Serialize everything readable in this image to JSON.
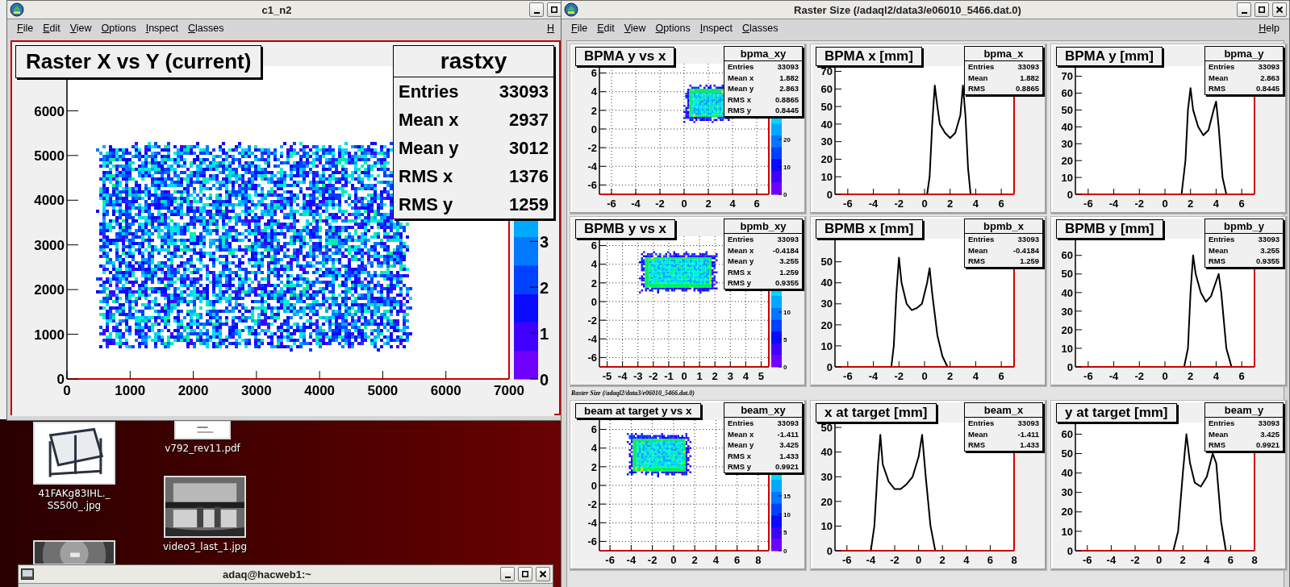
{
  "desktop": {
    "icons": [
      {
        "kind": "picture",
        "label_lines": [
          "41FAKg83IHL._",
          "SS500_.jpg"
        ]
      },
      {
        "kind": "picture",
        "label_lines": [
          "v792_rev11.pdf"
        ]
      },
      {
        "kind": "picture",
        "label_lines": [
          "video3_last_1.jpg"
        ]
      },
      {
        "kind": "picture"
      }
    ]
  },
  "windows": [
    {
      "title": "c1_n2",
      "buttons": [
        {
          "kind": "minimize"
        },
        {
          "kind": "maximize"
        }
      ],
      "menu": [
        "File",
        "Edit",
        "View",
        "Options",
        "Inspect",
        "Classes"
      ],
      "menu_right": "H",
      "pads": [
        {
          "kind": "hist2d_large",
          "title": "Raster X vs Y (current)",
          "xticks": [
            "0",
            "1000",
            "2000",
            "3000",
            "4000",
            "5000",
            "6000",
            "7000"
          ],
          "yticks": [
            "6000",
            "5000",
            "4000",
            "3000",
            "2000",
            "1000",
            "0"
          ],
          "palette_ticks": [
            "3",
            "2",
            "1",
            "0"
          ],
          "stats": {
            "name": "rastxy",
            "rows": [
              {
                "label": "Entries",
                "value": "33093"
              },
              {
                "label": "Mean x",
                "value": "2937"
              },
              {
                "label": "Mean y",
                "value": "3012"
              },
              {
                "label": "RMS x",
                "value": "1376"
              },
              {
                "label": "RMS y",
                "value": "1259"
              }
            ]
          }
        }
      ]
    },
    {
      "title": "Raster Size (/adaql2/data3/e06010_5466.dat.0)",
      "buttons": [
        {
          "kind": "minimize"
        },
        {
          "kind": "maximize"
        },
        {
          "kind": "close"
        }
      ],
      "menu": [
        "File",
        "Edit",
        "View",
        "Options",
        "Inspect",
        "Classes"
      ],
      "menu_right": "Help",
      "caption": "Raster Size (/adaql2/data3/e06010_5466.dat.0)",
      "pads": [
        {
          "kind": "hist2d",
          "title": "BPMA y vs x",
          "xticks": [
            "-6",
            "-4",
            "-2",
            "0",
            "2",
            "4",
            "6"
          ],
          "yticks": [
            "6",
            "4",
            "2",
            "0",
            "-2",
            "-4",
            "-6"
          ],
          "palette_ticks": [
            "20",
            "10",
            "0"
          ],
          "stats": {
            "name": "bpma_xy",
            "rows": [
              {
                "label": "Entries",
                "value": "33093"
              },
              {
                "label": "Mean x",
                "value": "1.882"
              },
              {
                "label": "Mean y",
                "value": "2.863"
              },
              {
                "label": "RMS x",
                "value": "0.8865"
              },
              {
                "label": "RMS y",
                "value": "0.8445"
              }
            ]
          }
        },
        {
          "kind": "hist1d",
          "title": "BPMA x [mm]",
          "stats": {
            "name": "bpma_x",
            "rows": [
              {
                "label": "Entries",
                "value": "33093"
              },
              {
                "label": "Mean",
                "value": "1.882"
              },
              {
                "label": "RMS",
                "value": "0.8865"
              }
            ]
          },
          "chart_data": {
            "type": "line",
            "xlim": [
              -7,
              7
            ],
            "ylim": [
              0,
              73
            ],
            "xticks": [
              -6,
              -4,
              -2,
              0,
              2,
              4,
              6
            ],
            "yticks": [
              0,
              10,
              20,
              30,
              40,
              50,
              60,
              70
            ],
            "x": [
              0.2,
              0.4,
              0.6,
              0.8,
              1.0,
              1.2,
              1.6,
              2.0,
              2.4,
              2.8,
              3.0,
              3.2,
              3.4,
              3.6
            ],
            "values": [
              0,
              10,
              40,
              62,
              50,
              40,
              35,
              32,
              35,
              45,
              62,
              45,
              15,
              0
            ]
          }
        },
        {
          "kind": "hist1d",
          "title": "BPMA y [mm]",
          "stats": {
            "name": "bpma_y",
            "rows": [
              {
                "label": "Entries",
                "value": "33093"
              },
              {
                "label": "Mean",
                "value": "2.863"
              },
              {
                "label": "RMS",
                "value": "0.8445"
              }
            ]
          },
          "chart_data": {
            "type": "line",
            "xlim": [
              -7,
              7
            ],
            "ylim": [
              0,
              76
            ],
            "xticks": [
              -6,
              -4,
              -2,
              0,
              2,
              4,
              6
            ],
            "yticks": [
              0,
              10,
              20,
              30,
              40,
              50,
              60,
              70
            ],
            "x": [
              1.3,
              1.6,
              1.8,
              2.0,
              2.2,
              2.6,
              3.0,
              3.4,
              3.8,
              4.0,
              4.2,
              4.5,
              4.8
            ],
            "values": [
              0,
              20,
              50,
              63,
              50,
              40,
              35,
              38,
              50,
              55,
              40,
              10,
              0
            ]
          }
        },
        {
          "kind": "hist2d",
          "title": "BPMB y vs x",
          "xticks": [
            "-5",
            "-4",
            "-3",
            "-2",
            "-1",
            "0",
            "1",
            "2",
            "3",
            "4",
            "5"
          ],
          "yticks": [
            "6",
            "4",
            "2",
            "0",
            "-2",
            "-4",
            "-6"
          ],
          "palette_ticks": [
            "10",
            "5",
            "0"
          ],
          "stats": {
            "name": "bpmb_xy",
            "rows": [
              {
                "label": "Entries",
                "value": "33093"
              },
              {
                "label": "Mean x",
                "value": "-0.4184"
              },
              {
                "label": "Mean y",
                "value": "3.255"
              },
              {
                "label": "RMS x",
                "value": "1.259"
              },
              {
                "label": "RMS y",
                "value": "0.9355"
              }
            ]
          }
        },
        {
          "kind": "hist1d",
          "title": "BPMB x [mm]",
          "stats": {
            "name": "bpmb_x",
            "rows": [
              {
                "label": "Entries",
                "value": "33093"
              },
              {
                "label": "Mean",
                "value": "-0.4184"
              },
              {
                "label": "RMS",
                "value": "1.259"
              }
            ]
          },
          "chart_data": {
            "type": "line",
            "xlim": [
              -7,
              7
            ],
            "ylim": [
              0,
              61
            ],
            "xticks": [
              -6,
              -4,
              -2,
              0,
              2,
              4,
              6
            ],
            "yticks": [
              0,
              10,
              20,
              30,
              40,
              50
            ],
            "x": [
              -2.6,
              -2.4,
              -2.2,
              -2.0,
              -1.8,
              -1.4,
              -1.0,
              -0.6,
              -0.2,
              0.2,
              0.4,
              0.6,
              1.0,
              1.4,
              1.8
            ],
            "values": [
              0,
              10,
              35,
              52,
              40,
              30,
              27,
              28,
              30,
              40,
              47,
              35,
              15,
              5,
              0
            ]
          }
        },
        {
          "kind": "hist1d",
          "title": "BPMB y [mm]",
          "stats": {
            "name": "bpmb_y",
            "rows": [
              {
                "label": "Entries",
                "value": "33093"
              },
              {
                "label": "Mean",
                "value": "3.255"
              },
              {
                "label": "RMS",
                "value": "0.9355"
              }
            ]
          },
          "chart_data": {
            "type": "line",
            "xlim": [
              -7,
              7
            ],
            "ylim": [
              0,
              69
            ],
            "xticks": [
              -6,
              -4,
              -2,
              0,
              2,
              4,
              6
            ],
            "yticks": [
              0,
              10,
              20,
              30,
              40,
              50,
              60
            ],
            "x": [
              1.5,
              1.8,
              2.0,
              2.2,
              2.4,
              2.8,
              3.2,
              3.6,
              4.0,
              4.2,
              4.4,
              4.8,
              5.2
            ],
            "values": [
              0,
              10,
              40,
              60,
              50,
              40,
              35,
              38,
              46,
              50,
              40,
              10,
              0
            ]
          }
        },
        {
          "kind": "hist2d",
          "title": "beam at target y vs x",
          "xticks": [
            "-6",
            "-4",
            "-2",
            "0",
            "2",
            "4",
            "6",
            "8"
          ],
          "yticks": [
            "6",
            "4",
            "2",
            "0",
            "-2",
            "-4",
            "-6"
          ],
          "palette_ticks": [
            "15",
            "10",
            "5",
            "0"
          ],
          "stats": {
            "name": "beam_xy",
            "rows": [
              {
                "label": "Entries",
                "value": "33093"
              },
              {
                "label": "Mean x",
                "value": "-1.411"
              },
              {
                "label": "Mean y",
                "value": "3.425"
              },
              {
                "label": "RMS x",
                "value": "1.433"
              },
              {
                "label": "RMS y",
                "value": "0.9921"
              }
            ]
          }
        },
        {
          "kind": "hist1d",
          "title": "x at target [mm]",
          "stats": {
            "name": "beam_x",
            "rows": [
              {
                "label": "Entries",
                "value": "33093"
              },
              {
                "label": "Mean",
                "value": "-1.411"
              },
              {
                "label": "RMS",
                "value": "1.433"
              }
            ]
          },
          "chart_data": {
            "type": "line",
            "xlim": [
              -7,
              8
            ],
            "ylim": [
              0,
              52
            ],
            "xticks": [
              -6,
              -4,
              -2,
              0,
              2,
              4,
              6,
              8
            ],
            "yticks": [
              0,
              10,
              20,
              30,
              40,
              50
            ],
            "x": [
              -4.0,
              -3.7,
              -3.4,
              -3.2,
              -3.0,
              -2.5,
              -2.0,
              -1.5,
              -1.0,
              -0.5,
              0.0,
              0.3,
              0.6,
              1.0,
              1.4
            ],
            "values": [
              0,
              10,
              35,
              47,
              35,
              28,
              25,
              25,
              27,
              30,
              38,
              47,
              30,
              10,
              0
            ]
          }
        },
        {
          "kind": "hist1d",
          "title": "y at target [mm]",
          "stats": {
            "name": "beam_y",
            "rows": [
              {
                "label": "Entries",
                "value": "33093"
              },
              {
                "label": "Mean",
                "value": "3.425"
              },
              {
                "label": "RMS",
                "value": "0.9921"
              }
            ]
          },
          "chart_data": {
            "type": "line",
            "xlim": [
              -7,
              8
            ],
            "ylim": [
              0,
              66
            ],
            "xticks": [
              -6,
              -4,
              -2,
              0,
              2,
              4,
              6,
              8
            ],
            "yticks": [
              0,
              10,
              20,
              30,
              40,
              50,
              60
            ],
            "x": [
              1.2,
              1.6,
              2.0,
              2.3,
              2.6,
              3.0,
              3.5,
              4.0,
              4.5,
              4.8,
              5.2,
              5.6
            ],
            "values": [
              0,
              10,
              40,
              60,
              45,
              35,
              33,
              38,
              50,
              45,
              15,
              0
            ]
          }
        }
      ]
    },
    {
      "title": "adaq@hacweb1:~",
      "buttons": [
        {
          "kind": "minimize"
        },
        {
          "kind": "maximize"
        },
        {
          "kind": "close"
        }
      ]
    }
  ]
}
